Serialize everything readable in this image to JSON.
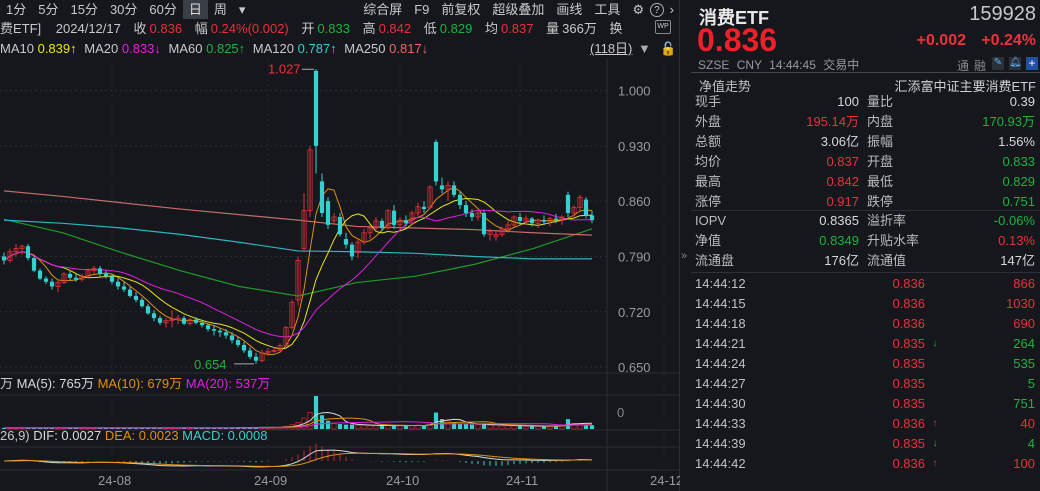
{
  "toolbar": {
    "periods": [
      "1分",
      "5分",
      "15分",
      "30分",
      "60分",
      "日",
      "周"
    ],
    "active": "日",
    "more": "▾",
    "tools": [
      "综合屏",
      "F9",
      "前复权",
      "超级叠加",
      "画线",
      "工具"
    ],
    "gear": "⚙",
    "help": "?",
    "next": "›"
  },
  "info": {
    "name": "费ETF]",
    "date": "2024/12/17",
    "close_label": "收",
    "close": "0.836",
    "chg_label": "幅",
    "chg": "0.24%(0.002)",
    "open_label": "开",
    "open": "0.833",
    "high_label": "高",
    "high": "0.842",
    "low_label": "低",
    "low": "0.829",
    "avg_label": "均",
    "avg": "0.837",
    "vol_label": "量",
    "vol": "366万",
    "turn_label": "换"
  },
  "ma": {
    "ma10_label": "MA10",
    "ma10": "0.839↑",
    "ma20_label": "MA20",
    "ma20": "0.833↓",
    "ma60_label": "MA60",
    "ma60": "0.825↑",
    "ma120_label": "MA120",
    "ma120": "0.787↑",
    "ma250_label": "MA250",
    "ma250": "0.817↓",
    "range": "(118日)"
  },
  "vol_legend": {
    "unit": "万",
    "ma5": "MA(5): 765万",
    "ma10": "MA(10): 679万",
    "ma20": "MA(20): 537万",
    "axis0": "0"
  },
  "macd_legend": {
    "params": "26,9)",
    "dif": "DIF: 0.0027",
    "dea": "DEA: 0.0023",
    "macd": "MACD: 0.0008"
  },
  "chart_data": {
    "type": "candlestick",
    "price_ticks": [
      "1.000",
      "0.930",
      "0.860",
      "0.790",
      "0.720",
      "0.650"
    ],
    "ylim": [
      0.645,
      1.04
    ],
    "max_label": "1.027",
    "min_label": "0.654",
    "date_ticks": [
      {
        "label": "24-08",
        "index": 18
      },
      {
        "label": "24-09",
        "index": 44
      },
      {
        "label": "24-10",
        "index": 66
      },
      {
        "label": "24-11",
        "index": 86
      },
      {
        "label": "24-12",
        "index": 110
      }
    ],
    "candles": [
      [
        0.79,
        0.795,
        0.78,
        0.785
      ],
      [
        0.785,
        0.8,
        0.782,
        0.796
      ],
      [
        0.796,
        0.806,
        0.79,
        0.8
      ],
      [
        0.8,
        0.805,
        0.792,
        0.803
      ],
      [
        0.803,
        0.806,
        0.785,
        0.788
      ],
      [
        0.788,
        0.79,
        0.77,
        0.772
      ],
      [
        0.772,
        0.775,
        0.76,
        0.762
      ],
      [
        0.762,
        0.765,
        0.755,
        0.758
      ],
      [
        0.758,
        0.762,
        0.748,
        0.752
      ],
      [
        0.752,
        0.76,
        0.745,
        0.757
      ],
      [
        0.757,
        0.77,
        0.755,
        0.768
      ],
      [
        0.768,
        0.772,
        0.76,
        0.763
      ],
      [
        0.763,
        0.768,
        0.758,
        0.761
      ],
      [
        0.761,
        0.768,
        0.758,
        0.765
      ],
      [
        0.765,
        0.775,
        0.762,
        0.772
      ],
      [
        0.772,
        0.778,
        0.768,
        0.775
      ],
      [
        0.775,
        0.778,
        0.765,
        0.768
      ],
      [
        0.768,
        0.772,
        0.762,
        0.765
      ],
      [
        0.765,
        0.768,
        0.755,
        0.758
      ],
      [
        0.758,
        0.762,
        0.748,
        0.752
      ],
      [
        0.752,
        0.758,
        0.745,
        0.748
      ],
      [
        0.748,
        0.752,
        0.738,
        0.74
      ],
      [
        0.74,
        0.745,
        0.732,
        0.735
      ],
      [
        0.735,
        0.738,
        0.725,
        0.727
      ],
      [
        0.727,
        0.73,
        0.716,
        0.718
      ],
      [
        0.718,
        0.722,
        0.708,
        0.712
      ],
      [
        0.712,
        0.715,
        0.703,
        0.706
      ],
      [
        0.706,
        0.712,
        0.7,
        0.709
      ],
      [
        0.709,
        0.722,
        0.7,
        0.71
      ],
      [
        0.71,
        0.716,
        0.704,
        0.712
      ],
      [
        0.712,
        0.715,
        0.703,
        0.705
      ],
      [
        0.705,
        0.712,
        0.702,
        0.71
      ],
      [
        0.71,
        0.713,
        0.704,
        0.706
      ],
      [
        0.706,
        0.71,
        0.7,
        0.703
      ],
      [
        0.703,
        0.706,
        0.695,
        0.698
      ],
      [
        0.698,
        0.702,
        0.69,
        0.696
      ],
      [
        0.696,
        0.699,
        0.688,
        0.694
      ],
      [
        0.694,
        0.698,
        0.686,
        0.69
      ],
      [
        0.69,
        0.694,
        0.68,
        0.684
      ],
      [
        0.684,
        0.688,
        0.675,
        0.678
      ],
      [
        0.678,
        0.682,
        0.668,
        0.671
      ],
      [
        0.671,
        0.675,
        0.66,
        0.663
      ],
      [
        0.663,
        0.668,
        0.654,
        0.658
      ],
      [
        0.658,
        0.672,
        0.656,
        0.668
      ],
      [
        0.668,
        0.674,
        0.664,
        0.67
      ],
      [
        0.67,
        0.675,
        0.668,
        0.671
      ],
      [
        0.671,
        0.68,
        0.669,
        0.677
      ],
      [
        0.677,
        0.702,
        0.676,
        0.7
      ],
      [
        0.7,
        0.735,
        0.698,
        0.732
      ],
      [
        0.735,
        0.79,
        0.728,
        0.785
      ],
      [
        0.8,
        0.87,
        0.795,
        0.848
      ],
      [
        0.848,
        0.93,
        0.84,
        0.925
      ],
      [
        1.025,
        1.027,
        0.895,
        0.93
      ],
      [
        0.885,
        0.895,
        0.84,
        0.845
      ],
      [
        0.86,
        0.865,
        0.825,
        0.83
      ],
      [
        0.835,
        0.845,
        0.83,
        0.84
      ],
      [
        0.84,
        0.845,
        0.815,
        0.818
      ],
      [
        0.812,
        0.82,
        0.8,
        0.805
      ],
      [
        0.805,
        0.808,
        0.785,
        0.79
      ],
      [
        0.795,
        0.812,
        0.788,
        0.808
      ],
      [
        0.808,
        0.825,
        0.805,
        0.82
      ],
      [
        0.82,
        0.83,
        0.812,
        0.826
      ],
      [
        0.826,
        0.84,
        0.822,
        0.835
      ],
      [
        0.835,
        0.838,
        0.822,
        0.826
      ],
      [
        0.826,
        0.85,
        0.824,
        0.848
      ],
      [
        0.848,
        0.855,
        0.825,
        0.83
      ],
      [
        0.83,
        0.84,
        0.825,
        0.836
      ],
      [
        0.836,
        0.842,
        0.828,
        0.832
      ],
      [
        0.832,
        0.848,
        0.83,
        0.845
      ],
      [
        0.845,
        0.858,
        0.84,
        0.853
      ],
      [
        0.853,
        0.86,
        0.845,
        0.85
      ],
      [
        0.852,
        0.88,
        0.85,
        0.878
      ],
      [
        0.935,
        0.938,
        0.88,
        0.885
      ],
      [
        0.88,
        0.89,
        0.87,
        0.875
      ],
      [
        0.875,
        0.885,
        0.86,
        0.88
      ],
      [
        0.88,
        0.885,
        0.865,
        0.868
      ],
      [
        0.868,
        0.872,
        0.85,
        0.855
      ],
      [
        0.855,
        0.86,
        0.84,
        0.845
      ],
      [
        0.845,
        0.85,
        0.835,
        0.84
      ],
      [
        0.84,
        0.848,
        0.835,
        0.845
      ],
      [
        0.845,
        0.848,
        0.815,
        0.818
      ],
      [
        0.818,
        0.825,
        0.81,
        0.822
      ],
      [
        0.815,
        0.822,
        0.81,
        0.818
      ],
      [
        0.818,
        0.828,
        0.815,
        0.825
      ],
      [
        0.825,
        0.835,
        0.82,
        0.83
      ],
      [
        0.83,
        0.842,
        0.828,
        0.84
      ],
      [
        0.84,
        0.845,
        0.83,
        0.835
      ],
      [
        0.835,
        0.842,
        0.83,
        0.838
      ],
      [
        0.838,
        0.84,
        0.828,
        0.832
      ],
      [
        0.832,
        0.838,
        0.826,
        0.836
      ],
      [
        0.836,
        0.842,
        0.83,
        0.834
      ],
      [
        0.834,
        0.84,
        0.828,
        0.838
      ],
      [
        0.838,
        0.844,
        0.832,
        0.836
      ],
      [
        0.836,
        0.842,
        0.83,
        0.84
      ],
      [
        0.868,
        0.872,
        0.84,
        0.845
      ],
      [
        0.845,
        0.855,
        0.84,
        0.852
      ],
      [
        0.852,
        0.868,
        0.848,
        0.865
      ],
      [
        0.862,
        0.865,
        0.838,
        0.842
      ],
      [
        0.842,
        0.848,
        0.832,
        0.836
      ]
    ],
    "long_ma": {
      "ma60": [
        0.837,
        0.82,
        0.795,
        0.772,
        0.752,
        0.74,
        0.757,
        0.765,
        0.78,
        0.8,
        0.825
      ],
      "ma120": [
        0.836,
        0.832,
        0.826,
        0.818,
        0.808,
        0.797,
        0.796,
        0.794,
        0.79,
        0.787,
        0.787
      ],
      "ma250": [
        0.873,
        0.866,
        0.858,
        0.85,
        0.843,
        0.836,
        0.828,
        0.826,
        0.824,
        0.82,
        0.817
      ]
    },
    "volume": [
      2,
      2,
      2,
      2,
      2,
      2,
      2,
      2,
      2,
      2,
      2,
      2,
      2,
      2,
      2,
      2,
      2,
      2,
      2,
      2,
      2,
      2,
      2,
      2,
      2,
      2,
      2,
      2,
      2,
      2,
      2,
      2,
      2,
      2,
      2,
      2,
      2,
      2,
      2,
      3,
      3,
      3,
      3,
      3,
      3,
      3,
      3,
      5,
      8,
      12,
      20,
      30,
      60,
      25,
      15,
      10,
      9,
      8,
      8,
      7,
      7,
      6,
      6,
      6,
      7,
      7,
      6,
      6,
      6,
      7,
      7,
      12,
      30,
      18,
      15,
      12,
      10,
      9,
      8,
      8,
      9,
      7,
      7,
      6,
      6,
      6,
      6,
      5,
      5,
      5,
      5,
      6,
      6,
      6,
      18,
      10,
      9,
      8,
      7
    ]
  },
  "quote": {
    "name": "消费ETF",
    "code": "159928",
    "price": "0.836",
    "change": "+0.002",
    "pct": "+0.24%",
    "exchange": "SZSE",
    "currency": "CNY",
    "time": "14:44:45",
    "status": "交易中",
    "tong": "通",
    "rong": "融",
    "nav_trend": "净值走势",
    "fund_name": "汇添富中证主要消费ETF"
  },
  "stats": [
    [
      "现手",
      "100",
      "w",
      "量比",
      "0.39",
      "w"
    ],
    [
      "外盘",
      "195.14万",
      "r",
      "内盘",
      "170.93万",
      "g"
    ],
    [
      "总额",
      "3.06亿",
      "w",
      "振幅",
      "1.56%",
      "w"
    ],
    [
      "均价",
      "0.837",
      "r",
      "开盘",
      "0.833",
      "g"
    ],
    [
      "最高",
      "0.842",
      "r",
      "最低",
      "0.829",
      "g"
    ],
    [
      "涨停",
      "0.917",
      "r",
      "跌停",
      "0.751",
      "g"
    ]
  ],
  "etf_stats": [
    [
      "IOPV",
      "0.8365",
      "w",
      "溢折率",
      "-0.06%",
      "g"
    ],
    [
      "净值",
      "0.8349",
      "g",
      "升贴水率",
      "0.13%",
      "r"
    ],
    [
      "流通盘",
      "176亿",
      "w",
      "流通值",
      "147亿",
      "w"
    ]
  ],
  "collapse": "»",
  "ticks": [
    [
      "14:44:12",
      "0.836",
      "",
      "866",
      "r"
    ],
    [
      "14:44:15",
      "0.836",
      "",
      "1030",
      "r"
    ],
    [
      "14:44:18",
      "0.836",
      "",
      "690",
      "r"
    ],
    [
      "14:44:21",
      "0.835",
      "↓",
      "264",
      "g"
    ],
    [
      "14:44:24",
      "0.835",
      "",
      "535",
      "g"
    ],
    [
      "14:44:27",
      "0.835",
      "",
      "5",
      "g"
    ],
    [
      "14:44:30",
      "0.835",
      "",
      "751",
      "g"
    ],
    [
      "14:44:33",
      "0.836",
      "↑",
      "40",
      "r"
    ],
    [
      "14:44:39",
      "0.835",
      "↓",
      "4",
      "g"
    ],
    [
      "14:44:42",
      "0.836",
      "↑",
      "100",
      "r"
    ]
  ]
}
